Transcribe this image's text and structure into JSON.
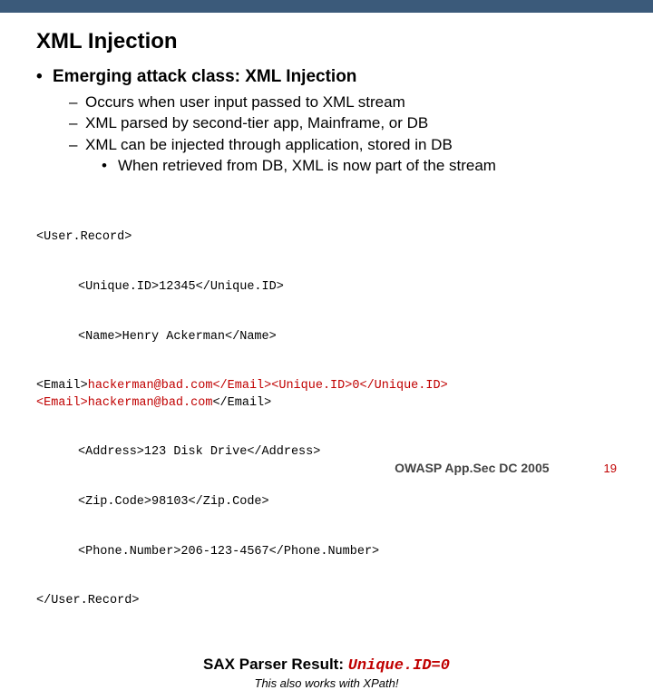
{
  "title": "XML Injection",
  "bullets": {
    "lvl1": "Emerging attack class: XML Injection",
    "l2a": "Occurs when user input passed to XML stream",
    "l2b": "XML parsed by second-tier app, Mainframe, or DB",
    "l2c": "XML can be injected through application, stored in DB",
    "l3a": "When retrieved from DB, XML is now part of the stream"
  },
  "code": {
    "line1": "<User.Record>",
    "line2": "<Unique.ID>12345</Unique.ID>",
    "line3": "<Name>Henry Ackerman</Name>",
    "line4a": "<Email>",
    "line4b_red": "hackerman@bad.com</Email><Unique.ID>0</Unique.ID><Email>hackerman@bad.com",
    "line4c": "</Email>",
    "line5": "<Address>123 Disk Drive</Address>",
    "line6": "<Zip.Code>98103</Zip.Code>",
    "line7": "<Phone.Number>206-123-4567</Phone.Number>",
    "line8": "</User.Record>"
  },
  "result": {
    "label": "SAX Parser Result: ",
    "value": "Unique.ID=0"
  },
  "note": "This also works with XPath!",
  "footer": {
    "brand": "OWASP App.Sec DC 2005",
    "page": "19"
  }
}
